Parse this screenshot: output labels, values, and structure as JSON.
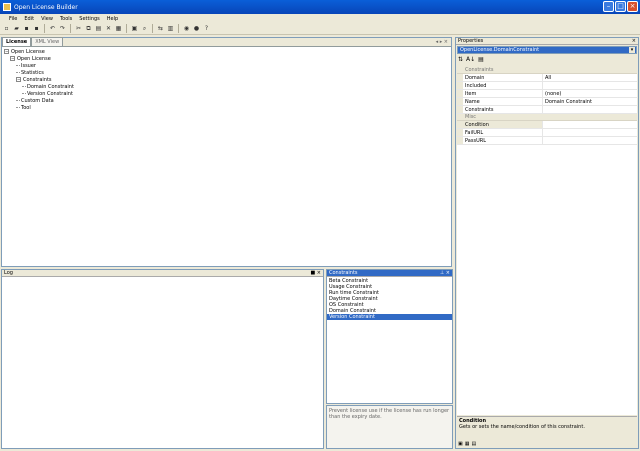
{
  "window": {
    "title": "Open License Builder"
  },
  "menu": [
    "File",
    "Edit",
    "View",
    "Tools",
    "Settings",
    "Help"
  ],
  "toolbar_icons": [
    "new-file-icon",
    "open-icon",
    "save-icon",
    "save-all-icon",
    "undo-icon",
    "redo-icon",
    "cut-icon",
    "copy-icon",
    "paste-icon",
    "delete-icon",
    "print-icon",
    "preview-icon",
    "find-icon",
    "replace-icon",
    "compile-icon",
    "run-icon",
    "debug-icon"
  ],
  "license_tabs": [
    "License",
    "XML View"
  ],
  "tree": [
    {
      "label": "Open License",
      "depth": 0,
      "expander": "−"
    },
    {
      "label": "Open License",
      "depth": 1,
      "expander": "−"
    },
    {
      "label": "Issuer",
      "depth": 2,
      "expander": ""
    },
    {
      "label": "Statistics",
      "depth": 2,
      "expander": ""
    },
    {
      "label": "Constraints",
      "depth": 2,
      "expander": "−"
    },
    {
      "label": "Domain Constraint",
      "depth": 3,
      "expander": ""
    },
    {
      "label": "Version Constraint",
      "depth": 3,
      "expander": ""
    },
    {
      "label": "Custom Data",
      "depth": 2,
      "expander": ""
    },
    {
      "label": "Tool",
      "depth": 2,
      "expander": ""
    }
  ],
  "log": {
    "title": "Log"
  },
  "constraints_panel": {
    "title": "Constraints",
    "items": [
      "Beta Constraint",
      "Usage Constraint",
      "Run time Constraint",
      "Daytime Constraint",
      "OS Constraint",
      "Domain Constraint",
      "Version Constraint"
    ],
    "selected_index": 6,
    "description": "Prevent license use if the license has run longer than the expiry date."
  },
  "properties": {
    "title": "Properties",
    "object_selector": "OpenLicense.DomainConstraint",
    "categories": [
      {
        "name": "Constraints",
        "rows": [
          {
            "key": "Domain",
            "value": "All"
          },
          {
            "key": "Included",
            "value": ""
          },
          {
            "key": "Item",
            "value": "(none)"
          },
          {
            "key": "Name",
            "value": "Domain Constraint"
          },
          {
            "key": "Constraints",
            "value": ""
          }
        ]
      },
      {
        "name": "Misc",
        "rows": [
          {
            "key": "Condition",
            "value": ""
          },
          {
            "key": "FailURL",
            "value": ""
          },
          {
            "key": "PassURL",
            "value": ""
          }
        ]
      }
    ],
    "selected_key": "Condition",
    "help_title": "Condition",
    "help_text": "Gets or sets the name/condition of this constraint."
  },
  "bottom_tabs_icons": [
    "properties-tab-icon",
    "toolbox-tab-icon",
    "class-tab-icon"
  ]
}
